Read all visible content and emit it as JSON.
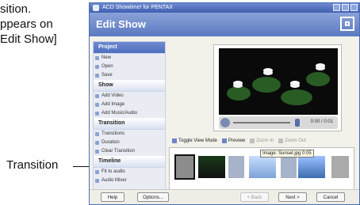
{
  "doc_text": {
    "lines": [
      "sition.",
      "ppears on",
      "Edit Show]"
    ]
  },
  "callout": {
    "label": "Transition"
  },
  "app": {
    "window_title": "ACD Showtime! for PENTAX",
    "header_title": "Edit Show"
  },
  "sidebar": {
    "sections": [
      {
        "title": "Project",
        "items": [
          "New",
          "Open",
          "Save"
        ]
      },
      {
        "title": "Show",
        "items": [
          "Add Video",
          "Add Image",
          "Add Music/Audio"
        ]
      },
      {
        "title": "Transition",
        "items": [
          "Transitions",
          "Duration",
          "Clear Transition"
        ]
      },
      {
        "title": "Timeline",
        "items": [
          "Fit to audio",
          "Audio Mixer"
        ]
      }
    ]
  },
  "preview": {
    "time": "0:00 / 0:01"
  },
  "timeline_toolbar": {
    "toggle_view_label": "Toggle View Mode",
    "preview_label": "Preview",
    "zoom_in_label": "Zoom In",
    "zoom_out_label": "Zoom Out"
  },
  "timeline": {
    "tooltip": "Image: Sunset.jpg 0:05"
  },
  "bottom_bar": {
    "help": "Help",
    "options": "Options...",
    "back": "< Back",
    "next": "Next >",
    "cancel": "Cancel"
  }
}
